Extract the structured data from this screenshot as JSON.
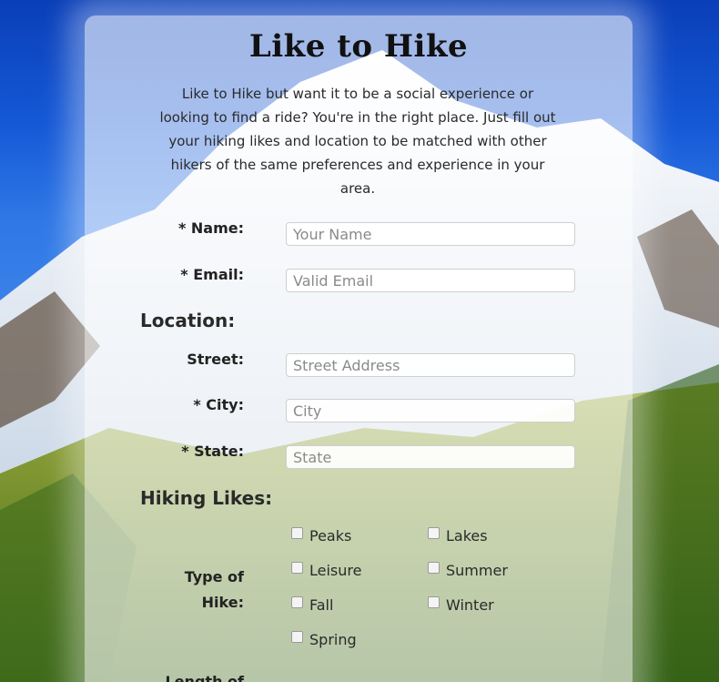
{
  "title": "Like to Hike",
  "intro": "Like to Hike but want it to be a social experience or looking to find a ride? You're in the right place. Just fill out your hiking likes and location to be matched with other hikers of the same preferences and experience in your area.",
  "form": {
    "name_label": "* Name:",
    "name_placeholder": "Your Name",
    "email_label": "* Email:",
    "email_placeholder": "Valid Email",
    "location_heading": "Location:",
    "street_label": "Street:",
    "street_placeholder": "Street Address",
    "city_label": "* City:",
    "city_placeholder": "City",
    "state_label": "* State:",
    "state_placeholder": "State",
    "hiking_heading": "Hiking Likes:",
    "type_label": "Type of Hike:",
    "options": [
      "Peaks",
      "Lakes",
      "Leisure",
      "Summer",
      "Fall",
      "Winter",
      "Spring"
    ],
    "next_label_partial": "Length of"
  },
  "colors": {
    "sky_top": "#0a3fb8",
    "sky": "#2f77e6",
    "forest": "#4d7a24"
  }
}
